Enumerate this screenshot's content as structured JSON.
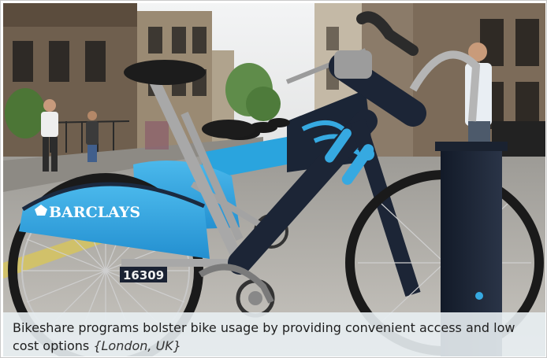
{
  "photo": {
    "subject": "row of docked shared bicycles on a city street",
    "brand_text": "BARCLAYS",
    "bike_number": "16309",
    "colors": {
      "fender_blue": "#36a9e1",
      "frame_dark": "#1c2536",
      "frame_silver": "#a8a8a8",
      "sky": "#eef0f2",
      "building": "#8b7b69",
      "foliage": "#5f8c4a",
      "road": "#b4b2ae",
      "dock": "#1b2333"
    }
  },
  "caption": {
    "text": "Bikeshare programs bolster bike usage by providing convenient access and low cost options",
    "place": "{London, UK}"
  }
}
